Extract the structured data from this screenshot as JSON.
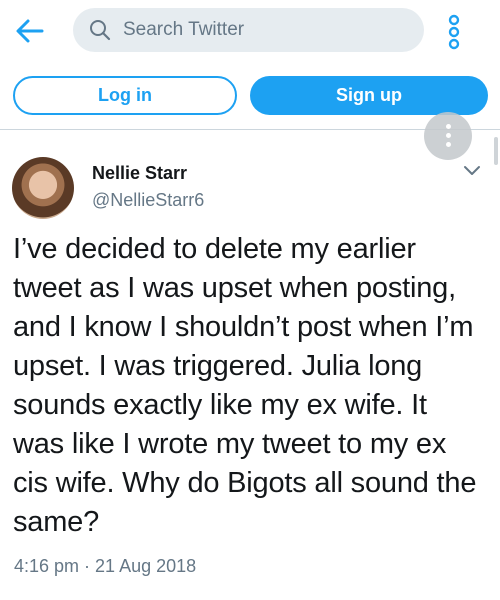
{
  "header": {
    "back_icon": "arrow-left-icon",
    "search_placeholder": "Search Twitter",
    "search_icon": "search-icon",
    "menu_icon": "vertical-dots-icon"
  },
  "auth": {
    "login_label": "Log in",
    "signup_label": "Sign up"
  },
  "floating_button": {
    "icon": "more-vertical-icon"
  },
  "tweet": {
    "author_name": "Nellie Starr",
    "author_handle": "@NellieStarr6",
    "caret_icon": "chevron-down-icon",
    "lines": [
      "I’ve decided to delete my earlier",
      "tweet as I was upset when posting,",
      "and I know I shouldn’t post when I’m",
      "upset. I was triggered. Julia long",
      "sounds exactly like my ex wife. It",
      "was like I wrote my tweet to my ex",
      "cis wife. Why do Bigots all sound the",
      "same?"
    ],
    "timestamp": "4:16 pm · 21 Aug 2018"
  },
  "colors": {
    "accent": "#1da1f2",
    "secondary_text": "#657786",
    "search_bg": "#e6ecf0"
  }
}
